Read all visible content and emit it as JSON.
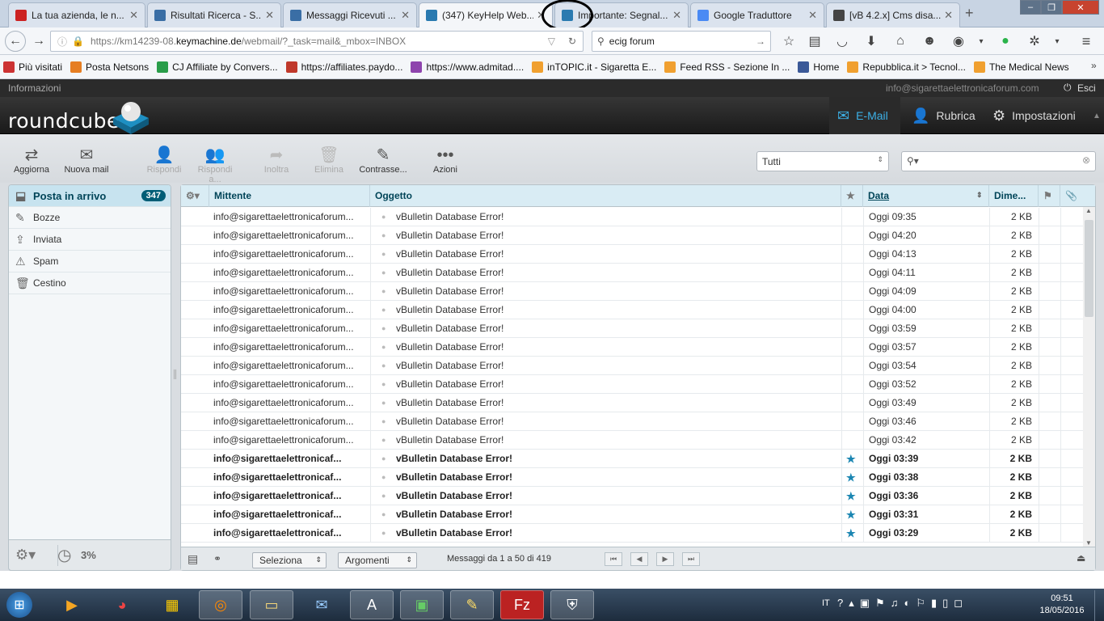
{
  "browser": {
    "tabs": [
      {
        "title": "La tua azienda, le n...",
        "active": false
      },
      {
        "title": "Risultati Ricerca - S...",
        "active": false
      },
      {
        "title": "Messaggi Ricevuti ...",
        "active": false
      },
      {
        "title": "(347) KeyHelp Web...",
        "active": true
      },
      {
        "title": "Importante: Segnal...",
        "active": false
      },
      {
        "title": "Google Traduttore",
        "active": false
      },
      {
        "title": "[vB 4.2.x] Cms disa...",
        "active": false
      }
    ],
    "new_tab": "+",
    "url_prefix": "https://km14239-08.",
    "url_host": "keymachine.de",
    "url_path": "/webmail/?_task=mail&_mbox=INBOX",
    "search_value": "ecig forum",
    "bookmarks": [
      {
        "label": "Più visitati"
      },
      {
        "label": "Posta Netsons"
      },
      {
        "label": "CJ Affiliate by Convers..."
      },
      {
        "label": "https://affiliates.paydo..."
      },
      {
        "label": "https://www.admitad...."
      },
      {
        "label": "inTOPIC.it - Sigaretta E..."
      },
      {
        "label": "Feed RSS - Sezione In ..."
      },
      {
        "label": "Home"
      },
      {
        "label": "Repubblica.it > Tecnol..."
      },
      {
        "label": "The Medical News"
      }
    ]
  },
  "app": {
    "topline_left": "Informazioni",
    "user_email": "info@sigarettaelettronicaforum.com",
    "logout": "Esci",
    "logo": "roundcube",
    "nav": {
      "mail": "E-Mail",
      "contacts": "Rubrica",
      "settings": "Impostazioni"
    },
    "accent": "#3cb0e6"
  },
  "toolbar": {
    "refresh": "Aggiorna",
    "compose": "Nuova mail",
    "reply": "Rispondi",
    "reply_all": "Rispondi a...",
    "forward": "Inoltra",
    "delete": "Elimina",
    "mark": "Contrasse...",
    "more": "Azioni",
    "filter_value": "Tutti"
  },
  "folders": [
    {
      "label": "Posta in arrivo",
      "count": "347",
      "selected": true,
      "icon": "inbox-icon"
    },
    {
      "label": "Bozze",
      "icon": "pencil-icon"
    },
    {
      "label": "Inviata",
      "icon": "sent-icon"
    },
    {
      "label": "Spam",
      "icon": "spam-icon"
    },
    {
      "label": "Cestino",
      "icon": "trash-icon"
    }
  ],
  "quota": "3%",
  "list": {
    "headers": {
      "from": "Mittente",
      "subject": "Oggetto",
      "date": "Data",
      "size": "Dime..."
    },
    "rows": [
      {
        "from": "info@sigarettaelettronicaforum...",
        "subject": "vBulletin Database Error!",
        "date": "Oggi 09:35",
        "size": "2 KB",
        "unread": false
      },
      {
        "from": "info@sigarettaelettronicaforum...",
        "subject": "vBulletin Database Error!",
        "date": "Oggi 04:20",
        "size": "2 KB",
        "unread": false
      },
      {
        "from": "info@sigarettaelettronicaforum...",
        "subject": "vBulletin Database Error!",
        "date": "Oggi 04:13",
        "size": "2 KB",
        "unread": false
      },
      {
        "from": "info@sigarettaelettronicaforum...",
        "subject": "vBulletin Database Error!",
        "date": "Oggi 04:11",
        "size": "2 KB",
        "unread": false
      },
      {
        "from": "info@sigarettaelettronicaforum...",
        "subject": "vBulletin Database Error!",
        "date": "Oggi 04:09",
        "size": "2 KB",
        "unread": false
      },
      {
        "from": "info@sigarettaelettronicaforum...",
        "subject": "vBulletin Database Error!",
        "date": "Oggi 04:00",
        "size": "2 KB",
        "unread": false
      },
      {
        "from": "info@sigarettaelettronicaforum...",
        "subject": "vBulletin Database Error!",
        "date": "Oggi 03:59",
        "size": "2 KB",
        "unread": false
      },
      {
        "from": "info@sigarettaelettronicaforum...",
        "subject": "vBulletin Database Error!",
        "date": "Oggi 03:57",
        "size": "2 KB",
        "unread": false
      },
      {
        "from": "info@sigarettaelettronicaforum...",
        "subject": "vBulletin Database Error!",
        "date": "Oggi 03:54",
        "size": "2 KB",
        "unread": false
      },
      {
        "from": "info@sigarettaelettronicaforum...",
        "subject": "vBulletin Database Error!",
        "date": "Oggi 03:52",
        "size": "2 KB",
        "unread": false
      },
      {
        "from": "info@sigarettaelettronicaforum...",
        "subject": "vBulletin Database Error!",
        "date": "Oggi 03:49",
        "size": "2 KB",
        "unread": false
      },
      {
        "from": "info@sigarettaelettronicaforum...",
        "subject": "vBulletin Database Error!",
        "date": "Oggi 03:46",
        "size": "2 KB",
        "unread": false
      },
      {
        "from": "info@sigarettaelettronicaforum...",
        "subject": "vBulletin Database Error!",
        "date": "Oggi 03:42",
        "size": "2 KB",
        "unread": false
      },
      {
        "from": "info@sigarettaelettronicaf...",
        "subject": "vBulletin Database Error!",
        "date": "Oggi 03:39",
        "size": "2 KB",
        "unread": true
      },
      {
        "from": "info@sigarettaelettronicaf...",
        "subject": "vBulletin Database Error!",
        "date": "Oggi 03:38",
        "size": "2 KB",
        "unread": true
      },
      {
        "from": "info@sigarettaelettronicaf...",
        "subject": "vBulletin Database Error!",
        "date": "Oggi 03:36",
        "size": "2 KB",
        "unread": true
      },
      {
        "from": "info@sigarettaelettronicaf...",
        "subject": "vBulletin Database Error!",
        "date": "Oggi 03:31",
        "size": "2 KB",
        "unread": true
      },
      {
        "from": "info@sigarettaelettronicaf...",
        "subject": "vBulletin Database Error!",
        "date": "Oggi 03:29",
        "size": "2 KB",
        "unread": true
      }
    ],
    "select_label": "Seleziona",
    "threads_label": "Argomenti",
    "count_text": "Messaggi da 1 a 50 di 419"
  },
  "taskbar": {
    "lang": "IT",
    "time": "09:51",
    "date": "18/05/2016"
  }
}
